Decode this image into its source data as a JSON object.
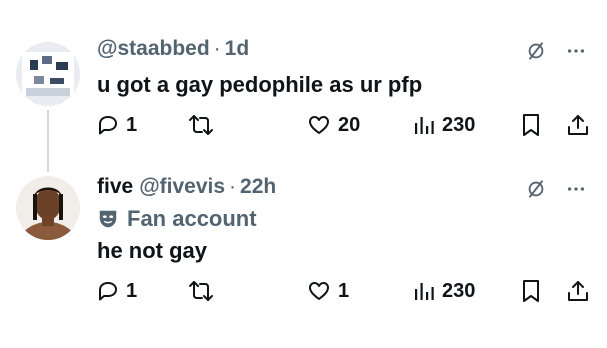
{
  "tweets": [
    {
      "handle": "@staabbed",
      "dot": "·",
      "time": "1d",
      "text": "u got a gay pedophile as ur pfp",
      "replies": "1",
      "likes": "20",
      "views": "230"
    },
    {
      "name": "five",
      "handle": "@fivevis",
      "dot": "·",
      "time": "22h",
      "label": "Fan account",
      "text": "he not gay",
      "replies": "1",
      "likes": "1",
      "views": "230"
    }
  ],
  "icons": {
    "reply": "reply-icon",
    "retweet": "retweet-icon",
    "like": "heart-icon",
    "views": "views-icon",
    "bookmark": "bookmark-icon",
    "share": "share-icon",
    "grok": "grok-icon",
    "more": "more-icon",
    "fan": "mask-icon"
  },
  "colors": {
    "text": "#0f1419",
    "secondary": "#536471",
    "thread_line": "#cfd9de"
  }
}
